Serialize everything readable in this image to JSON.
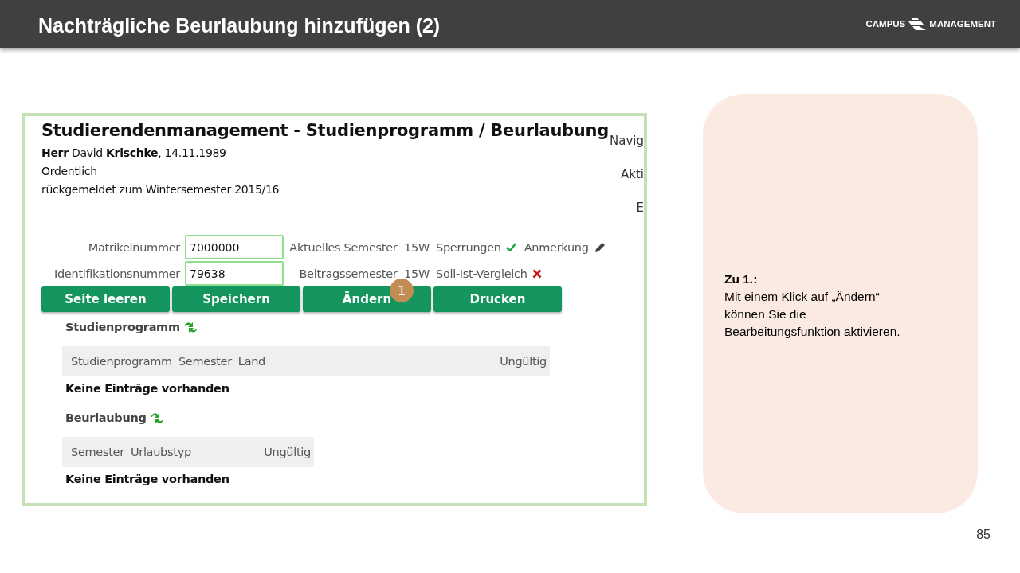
{
  "header": {
    "title": "Nachträgliche Beurlaubung hinzufügen (2)",
    "logo": [
      "CAMPUS",
      "MANAGEMENT"
    ]
  },
  "screenshot": {
    "title": "Studierendenmanagement - Studienprogramm / Beurlaubung",
    "info_lines": [
      "**Herr** David **Krischke**, 14.11.1989",
      "Ordentlich",
      "rückgemeldet zum Wintersemester 2015/16"
    ],
    "side_labels": [
      "Navig",
      "Akti",
      "E"
    ],
    "fields": [
      {
        "label": "Matrikelnummer",
        "value": "7000000",
        "info": "Aktuelles Semester  15W",
        "flags": [
          {
            "label": "Sperrungen",
            "kind": "ok"
          },
          {
            "label": "Anmerkung",
            "kind": "edit"
          }
        ]
      },
      {
        "label": "Identifikationsnummer",
        "value": "79638",
        "info": "Beitragssemester  15W",
        "flags": [
          {
            "label": "Soll-Ist-Vergleich",
            "kind": "error"
          }
        ]
      }
    ],
    "buttons": [
      {
        "label": "Seite leeren"
      },
      {
        "label": "Speichern"
      },
      {
        "label": "Ändern",
        "badge": "1"
      },
      {
        "label": "Drucken"
      }
    ],
    "sections": [
      {
        "title": "Studienprogramm",
        "columns": [
          "Studienprogramm",
          "Semester",
          "Land"
        ],
        "last_column": "Ungültig",
        "empty_text": "Keine Einträge vorhanden"
      },
      {
        "title": "Beurlaubung",
        "columns": [
          "Semester",
          "Urlaubstyp"
        ],
        "last_column": "Ungültig",
        "empty_text": "Keine Einträge vorhanden"
      }
    ]
  },
  "callout": {
    "title": "Zu 1.:",
    "lines": [
      "Mit einem Klick auf „Ändern“",
      "können Sie die",
      "Bearbeitungsfunktion aktivieren."
    ]
  },
  "page_number": "85"
}
